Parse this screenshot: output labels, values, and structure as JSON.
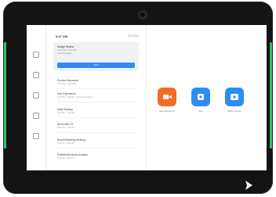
{
  "device": {
    "brand_colors": {
      "bezel": "#141414",
      "accent": "#37c06a"
    }
  },
  "header": {
    "time": "8:47 AM",
    "edit_label": "Edit Home"
  },
  "rail": {
    "items": [
      {
        "icon": "home-icon",
        "label": ""
      },
      {
        "icon": "phone-icon",
        "label": ""
      },
      {
        "icon": "calendar-icon",
        "label": ""
      },
      {
        "icon": "pen-icon",
        "label": ""
      },
      {
        "icon": "settings-icon",
        "label": ""
      }
    ]
  },
  "current_meeting": {
    "title": "Design Review",
    "line1": "10:00 AM - 11:00 AM",
    "line2": "Joined meeting",
    "start_label": "Start"
  },
  "meetings": [
    {
      "title": "Product Discussion",
      "time": "11:00 AM - 12:00 PM"
    },
    {
      "title": "User Experience",
      "time": "1:00 PM - 2:00 PM · Conference Room"
    },
    {
      "title": "Daily Standup",
      "time": "2:00 PM - 3:00 PM"
    },
    {
      "title": "Demo with CS",
      "time": "3:00 PM - 4:00 PM"
    },
    {
      "title": "Brand Marketing Meeting",
      "time": "4:00 PM - 5:00 PM"
    },
    {
      "title": "Potential Business Analysis",
      "time": "5:00 PM - 6:00 PM"
    }
  ],
  "actions": [
    {
      "label": "New Meeting ▾",
      "color": "#f26d21",
      "icon": "video-icon"
    },
    {
      "label": "Join",
      "color": "#2e8cf4",
      "icon": "join-icon"
    },
    {
      "label": "Share Screen",
      "color": "#2e8cf4",
      "icon": "share-screen-icon"
    }
  ]
}
